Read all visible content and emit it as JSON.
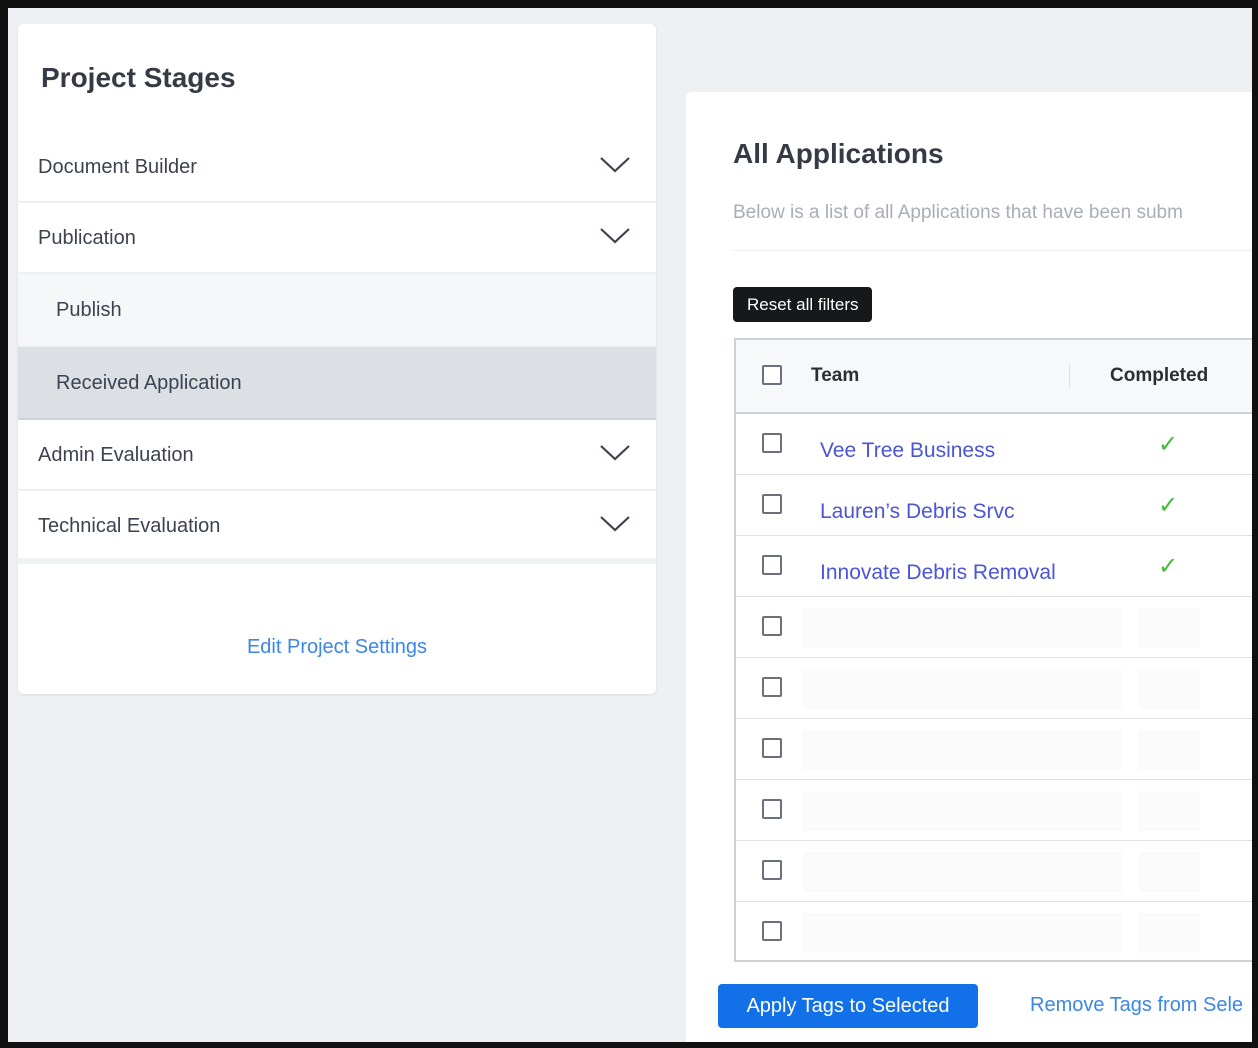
{
  "sidebar": {
    "title": "Project Stages",
    "stages": [
      {
        "label": "Document Builder",
        "type": "group",
        "icon": "chevron-down-icon"
      },
      {
        "label": "Publication",
        "type": "group",
        "icon": "chevron-down-icon"
      },
      {
        "label": "Publish",
        "type": "sub"
      },
      {
        "label": "Received Application",
        "type": "sub",
        "active": true
      },
      {
        "label": "Admin Evaluation",
        "type": "group",
        "icon": "chevron-down-icon"
      },
      {
        "label": "Technical Evaluation",
        "type": "group",
        "icon": "chevron-down-icon"
      }
    ],
    "edit_link": "Edit Project Settings"
  },
  "main": {
    "title": "All Applications",
    "subtitle": "Below is a list of all Applications that have been subm",
    "reset_button": "Reset all filters",
    "table": {
      "headers": [
        "Team",
        "Completed"
      ],
      "rows": [
        {
          "team": "Vee Tree Business",
          "completed": "✓"
        },
        {
          "team": "Lauren’s Debris Srvc",
          "completed": "✓"
        },
        {
          "team": "Innovate Debris Removal",
          "completed": "✓"
        },
        {
          "team": "",
          "completed": ""
        },
        {
          "team": "",
          "completed": ""
        },
        {
          "team": "",
          "completed": ""
        },
        {
          "team": "",
          "completed": ""
        },
        {
          "team": "",
          "completed": ""
        },
        {
          "team": "",
          "completed": ""
        }
      ]
    },
    "apply_button": "Apply Tags to Selected",
    "remove_link": "Remove Tags from Sele"
  },
  "colors": {
    "accent": "#1271e8",
    "link": "#3b86e6",
    "team_link": "#4b55d6",
    "check": "#3fbf3a",
    "active_row": "#dcdfe4"
  }
}
